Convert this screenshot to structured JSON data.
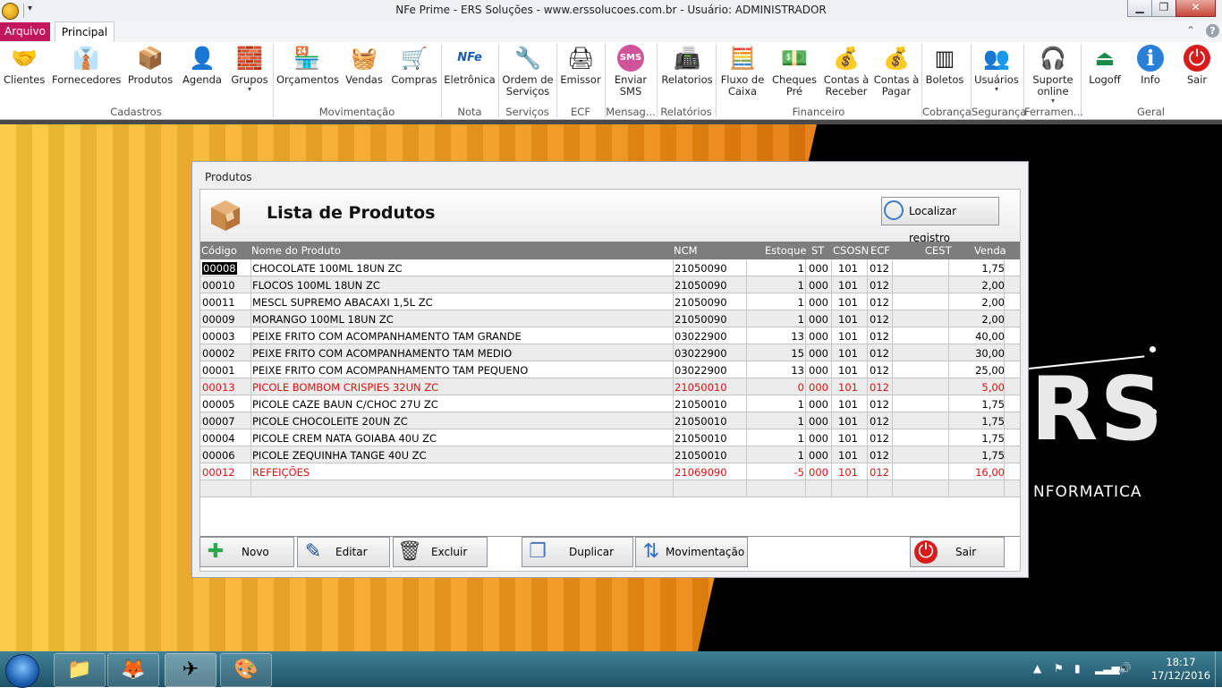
{
  "window": {
    "title": "NFe Prime - ERS Soluções - www.erssolucoes.com.br - Usuário: ADMINISTRADOR"
  },
  "window_controls": {
    "minimize": "▁",
    "maximize": "❐",
    "close": "✕"
  },
  "tabs": {
    "arquivo": "Arquivo",
    "principal": "Principal"
  },
  "ribbon": {
    "buttons": [
      {
        "label": "Clientes",
        "icon": "handshake-icon",
        "glyph": "🤝"
      },
      {
        "label": "Fornecedores",
        "icon": "person-suit-icon",
        "glyph": "👔"
      },
      {
        "label": "Produtos",
        "icon": "box-icon",
        "glyph": "📦"
      },
      {
        "label": "Agenda",
        "icon": "agenda-person-icon",
        "glyph": "👤"
      },
      {
        "label": "Grupos",
        "icon": "boxes-icon",
        "glyph": "🧱"
      },
      {
        "label": "Orçamentos",
        "icon": "shop-icon",
        "glyph": "🏪"
      },
      {
        "label": "Vendas",
        "icon": "basket-icon",
        "glyph": "🧺"
      },
      {
        "label": "Compras",
        "icon": "cart-icon",
        "glyph": "🛒"
      },
      {
        "label": "Eletrônica",
        "icon": "nfe-icon",
        "glyph": "NFe"
      },
      {
        "label": "Ordem de Serviços",
        "icon": "tools-icon",
        "glyph": "🔧"
      },
      {
        "label": "Emissor",
        "icon": "printer-icon",
        "glyph": "🖨"
      },
      {
        "label": "Enviar SMS",
        "icon": "sms-icon",
        "glyph": "SMS"
      },
      {
        "label": "Relatorios",
        "icon": "report-printer-icon",
        "glyph": "📠"
      },
      {
        "label": "Fluxo de Caixa",
        "icon": "cash-register-icon",
        "glyph": "🧮"
      },
      {
        "label": "Cheques Pré",
        "icon": "cheque-icon",
        "glyph": "💵"
      },
      {
        "label": "Contas à Receber",
        "icon": "money-bag-icon",
        "glyph": "💰"
      },
      {
        "label": "Contas à Pagar",
        "icon": "money-bag-pay-icon",
        "glyph": "💰"
      },
      {
        "label": "Boletos",
        "icon": "barcode-icon",
        "glyph": "▥"
      },
      {
        "label": "Usuários",
        "icon": "users-icon",
        "glyph": "👥"
      },
      {
        "label": "Suporte online",
        "icon": "support-icon",
        "glyph": "🎧"
      },
      {
        "label": "Logoff",
        "icon": "logoff-icon",
        "glyph": "⏏"
      },
      {
        "label": "Info",
        "icon": "info-icon",
        "glyph": "ℹ"
      },
      {
        "label": "Sair",
        "icon": "power-icon",
        "glyph": "⏻"
      }
    ],
    "groups": [
      "Cadastros",
      "Movimentação",
      "Nota Fiscal",
      "Serviços",
      "ECF",
      "Mensag...",
      "Relatórios",
      "Financeiro",
      "Cobrança",
      "Segurança",
      "Ferramen...",
      "Geral"
    ]
  },
  "background": {
    "brand": "RS",
    "brand_sub": "NFORMATICA"
  },
  "products_window": {
    "title": "Produtos",
    "header_title": "Lista de Produtos",
    "search_button": "Localizar registro",
    "columns": {
      "codigo": "Código",
      "nome": "Nome do Produto",
      "ncm": "NCM",
      "estoque": "Estoque",
      "st": "ST",
      "csosn": "CSOSN",
      "ecf": "ECF",
      "cest": "CEST",
      "venda": "Venda"
    },
    "rows": [
      {
        "codigo": "00008",
        "nome": "CHOCOLATE 100ML 18UN ZC",
        "ncm": "21050090",
        "estoque": "1",
        "st": "000",
        "csosn": "101",
        "ecf": "012",
        "cest": "",
        "venda": "1,75",
        "red": false
      },
      {
        "codigo": "00010",
        "nome": "FLOCOS 100ML 18UN ZC",
        "ncm": "21050090",
        "estoque": "1",
        "st": "000",
        "csosn": "101",
        "ecf": "012",
        "cest": "",
        "venda": "2,00",
        "red": false
      },
      {
        "codigo": "00011",
        "nome": "MESCL SUPREMO ABACAXI 1,5L ZC",
        "ncm": "21050090",
        "estoque": "1",
        "st": "000",
        "csosn": "101",
        "ecf": "012",
        "cest": "",
        "venda": "2,00",
        "red": false
      },
      {
        "codigo": "00009",
        "nome": "MORANGO 100ML 18UN ZC",
        "ncm": "21050090",
        "estoque": "1",
        "st": "000",
        "csosn": "101",
        "ecf": "012",
        "cest": "",
        "venda": "2,00",
        "red": false
      },
      {
        "codigo": "00003",
        "nome": "PEIXE FRITO COM ACOMPANHAMENTO TAM GRANDE",
        "ncm": "03022900",
        "estoque": "13",
        "st": "000",
        "csosn": "101",
        "ecf": "012",
        "cest": "",
        "venda": "40,00",
        "red": false
      },
      {
        "codigo": "00002",
        "nome": "PEIXE FRITO COM ACOMPANHAMENTO TAM MEDIO",
        "ncm": "03022900",
        "estoque": "15",
        "st": "000",
        "csosn": "101",
        "ecf": "012",
        "cest": "",
        "venda": "30,00",
        "red": false
      },
      {
        "codigo": "00001",
        "nome": "PEIXE FRITO COM ACOMPANHAMENTO TAM PEQUENO",
        "ncm": "03022900",
        "estoque": "13",
        "st": "000",
        "csosn": "101",
        "ecf": "012",
        "cest": "",
        "venda": "25,00",
        "red": false
      },
      {
        "codigo": "00013",
        "nome": "PICOLE BOMBOM CRISPIES 32UN ZC",
        "ncm": "21050010",
        "estoque": "0",
        "st": "000",
        "csosn": "101",
        "ecf": "012",
        "cest": "",
        "venda": "5,00",
        "red": true
      },
      {
        "codigo": "00005",
        "nome": "PICOLE CAZE BAUN C/CHOC 27U ZC",
        "ncm": "21050010",
        "estoque": "1",
        "st": "000",
        "csosn": "101",
        "ecf": "012",
        "cest": "",
        "venda": "1,75",
        "red": false
      },
      {
        "codigo": "00007",
        "nome": "PICOLE CHOCOLEITE 20UN ZC",
        "ncm": "21050010",
        "estoque": "1",
        "st": "000",
        "csosn": "101",
        "ecf": "012",
        "cest": "",
        "venda": "1,75",
        "red": false
      },
      {
        "codigo": "00004",
        "nome": "PICOLE CREM NATA GOIABA 40U ZC",
        "ncm": "21050010",
        "estoque": "1",
        "st": "000",
        "csosn": "101",
        "ecf": "012",
        "cest": "",
        "venda": "1,75",
        "red": false
      },
      {
        "codigo": "00006",
        "nome": "PICOLE ZEQUINHA TANGE 40U ZC",
        "ncm": "21050010",
        "estoque": "1",
        "st": "000",
        "csosn": "101",
        "ecf": "012",
        "cest": "",
        "venda": "1,75",
        "red": false
      },
      {
        "codigo": "00012",
        "nome": "REFEIÇÕES",
        "ncm": "21069090",
        "estoque": "-5",
        "st": "000",
        "csosn": "101",
        "ecf": "012",
        "cest": "",
        "venda": "16,00",
        "red": true
      }
    ],
    "buttons": {
      "novo": "Novo",
      "editar": "Editar",
      "excluir": "Excluir",
      "duplicar": "Duplicar",
      "movimentacao": "Movimentação",
      "sair": "Sair"
    }
  },
  "taskbar": {
    "time": "18:17",
    "date": "17/12/2016"
  },
  "colors": {
    "accent": "#c2185b",
    "red_row": "#e01010",
    "grid_header": "#7d7d7d"
  }
}
